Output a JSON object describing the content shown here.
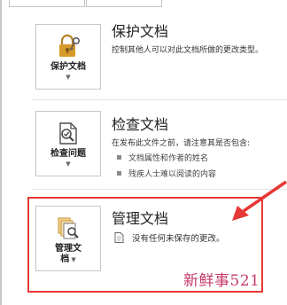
{
  "colors": {
    "accent_red": "#e53935",
    "lock_gold": "#d79b2b",
    "watermark": "#c53a6b"
  },
  "protect": {
    "tile_label": "保护文档",
    "icon": "lock-key-icon",
    "title": "保护文档",
    "desc": "控制其他人可以对此文档所做的更改类型。"
  },
  "inspect": {
    "tile_label": "检查问题",
    "icon": "document-inspect-icon",
    "title": "检查文档",
    "desc": "在发布此文件之前，请注意其是否包含:",
    "bullets": [
      "文档属性和作者的姓名",
      "残疾人士难以阅读的内容"
    ]
  },
  "manage": {
    "tile_label_line1": "管理文",
    "tile_label_line2": "档",
    "icon": "manage-versions-icon",
    "title": "管理文档",
    "status_icon": "document-icon",
    "status": "没有任何未保存的更改。"
  },
  "watermark": "新鲜事521"
}
